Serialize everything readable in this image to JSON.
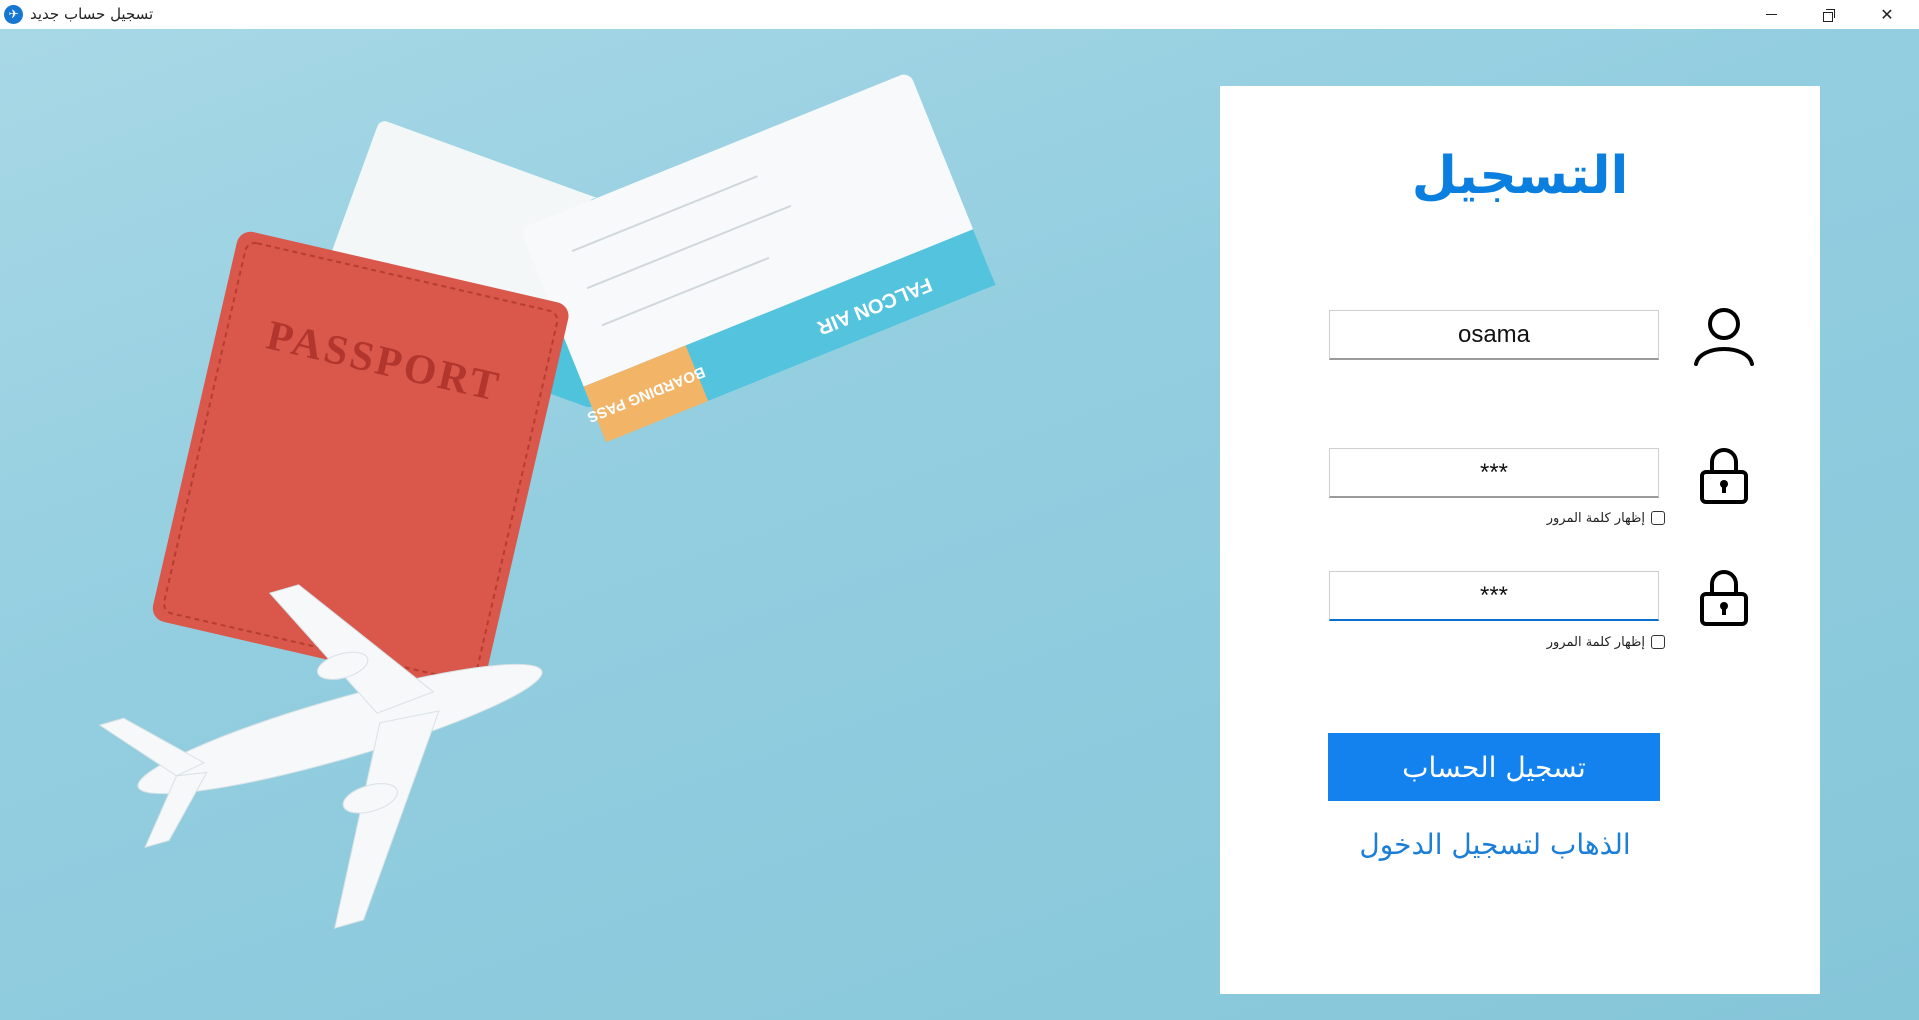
{
  "window": {
    "title": "تسجيل حساب جديد",
    "icon": "plane-logo-icon",
    "controls": [
      "minimize-icon",
      "restore-icon",
      "close-icon"
    ]
  },
  "form": {
    "heading": "التسجيل",
    "username_value": "osama",
    "password_value": "***",
    "confirm_password_value": "***",
    "show_password_label": "إظهار كلمة المرور",
    "show_password_label_2": "إظهار كلمة المرور",
    "show_password_checked": false,
    "show_password_2_checked": false,
    "submit_label": "تسجيل الحساب",
    "login_link": "الذهاب لتسجيل الدخول"
  },
  "background": {
    "passport_text": "PASSPORT",
    "ticket_airline": "FALCON AIR",
    "ticket_label": "BOARDING PASS"
  },
  "colors": {
    "accent": "#1482EE",
    "heading": "#0B7FE0",
    "background": "#93CEE0",
    "passport": "#D9574B"
  }
}
